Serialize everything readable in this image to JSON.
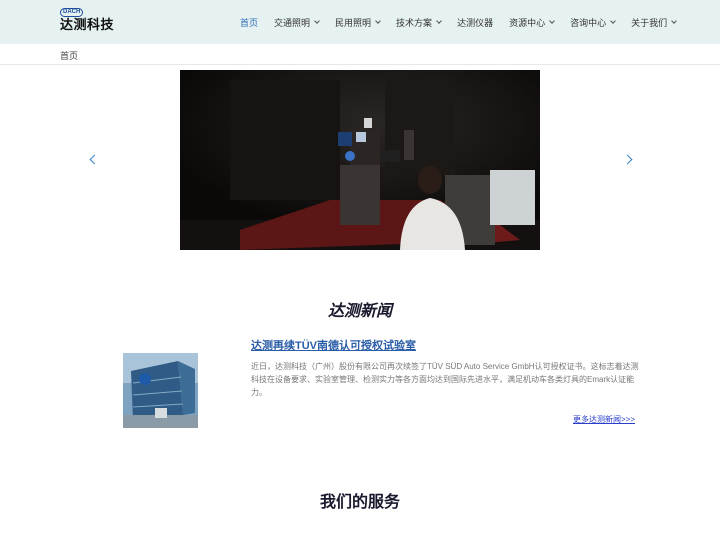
{
  "header": {
    "logo_badge": "DACH",
    "logo_text": "达测科技",
    "nav": [
      {
        "label": "首页",
        "active": true,
        "dropdown": false
      },
      {
        "label": "交通照明",
        "active": false,
        "dropdown": true
      },
      {
        "label": "民用照明",
        "active": false,
        "dropdown": true
      },
      {
        "label": "技术方案",
        "active": false,
        "dropdown": true
      },
      {
        "label": "达测仪器",
        "active": false,
        "dropdown": false
      },
      {
        "label": "资源中心",
        "active": false,
        "dropdown": true
      },
      {
        "label": "咨询中心",
        "active": false,
        "dropdown": true
      },
      {
        "label": "关于我们",
        "active": false,
        "dropdown": true
      }
    ]
  },
  "breadcrumb": {
    "current": "首页"
  },
  "carousel": {
    "prev_icon": "chevron-left-icon",
    "next_icon": "chevron-right-icon"
  },
  "news": {
    "section_title": "达测新闻",
    "headline": "达测再续TÜV南德认可授权试验室",
    "body": "近日，达测科技（广州）股份有限公司再次续签了TÜV SÜD Auto Service GmbH认可授权证书。这标志着达测科技在设备要求、实验室管理、检测实力等各方面均达到国际先进水平，满足机动车各类灯具的Emark认证能力。",
    "more_link": "更多达测新闻>>>"
  },
  "services": {
    "section_title": "我们的服务"
  },
  "colors": {
    "accent": "#2f6fb4",
    "header_bg": "#e6f1f1",
    "link": "#2a5ea8"
  }
}
